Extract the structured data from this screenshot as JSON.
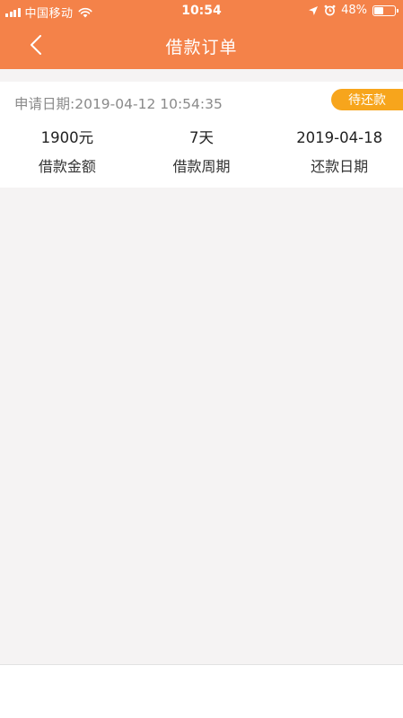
{
  "status_bar": {
    "carrier": "中国移动",
    "time": "10:54",
    "battery_percent": "48%",
    "battery_level": 0.48
  },
  "nav": {
    "title": "借款订单",
    "back_icon": "chevron-left-icon"
  },
  "order": {
    "apply_date": "申请日期:2019-04-12 10:54:35",
    "status": "待还款",
    "amount_value": "1900元",
    "amount_label": "借款金额",
    "period_value": "7天",
    "period_label": "借款周期",
    "repay_value": "2019-04-18",
    "repay_label": "还款日期"
  },
  "colors": {
    "header": "#f48249",
    "badge": "#f7a51c",
    "background": "#f5f3f3"
  }
}
